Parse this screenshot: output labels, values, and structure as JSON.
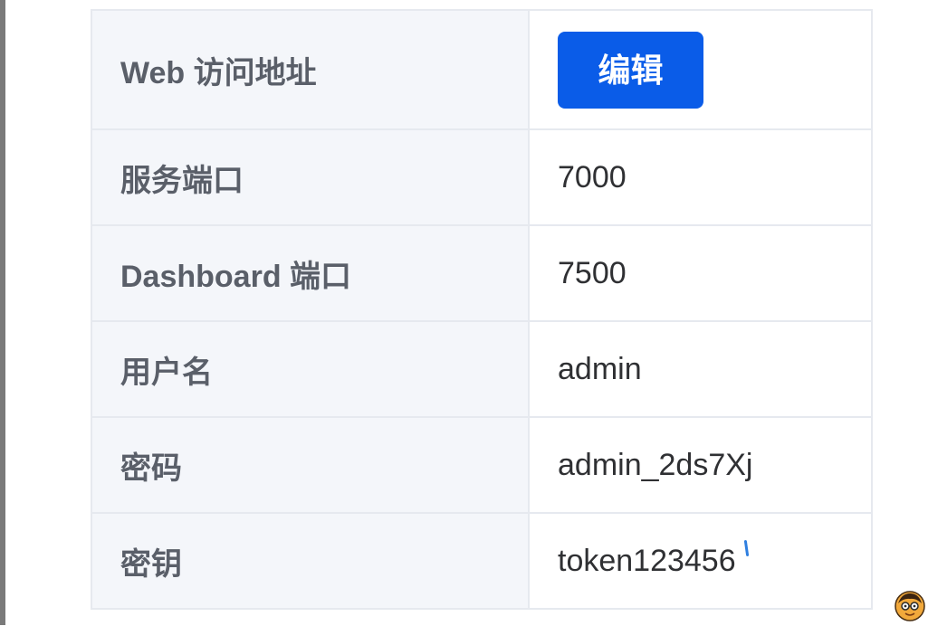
{
  "table": {
    "rows": [
      {
        "label": "Web 访问地址",
        "value": null,
        "action": "编辑"
      },
      {
        "label": "服务端口",
        "value": "7000"
      },
      {
        "label": "Dashboard 端口",
        "value": "7500"
      },
      {
        "label": "用户名",
        "value": "admin"
      },
      {
        "label": "密码",
        "value": "admin_2ds7Xj"
      },
      {
        "label": "密钥",
        "value": "token123456"
      }
    ]
  },
  "colors": {
    "accent": "#0a5ce8",
    "label_background": "#f4f6fa",
    "border": "#e6e9ef",
    "label_text": "#5a5f69",
    "value_text": "#2f3033"
  },
  "icons": {
    "avatar": "avatar-icon",
    "cursor": "text-cursor-icon"
  }
}
